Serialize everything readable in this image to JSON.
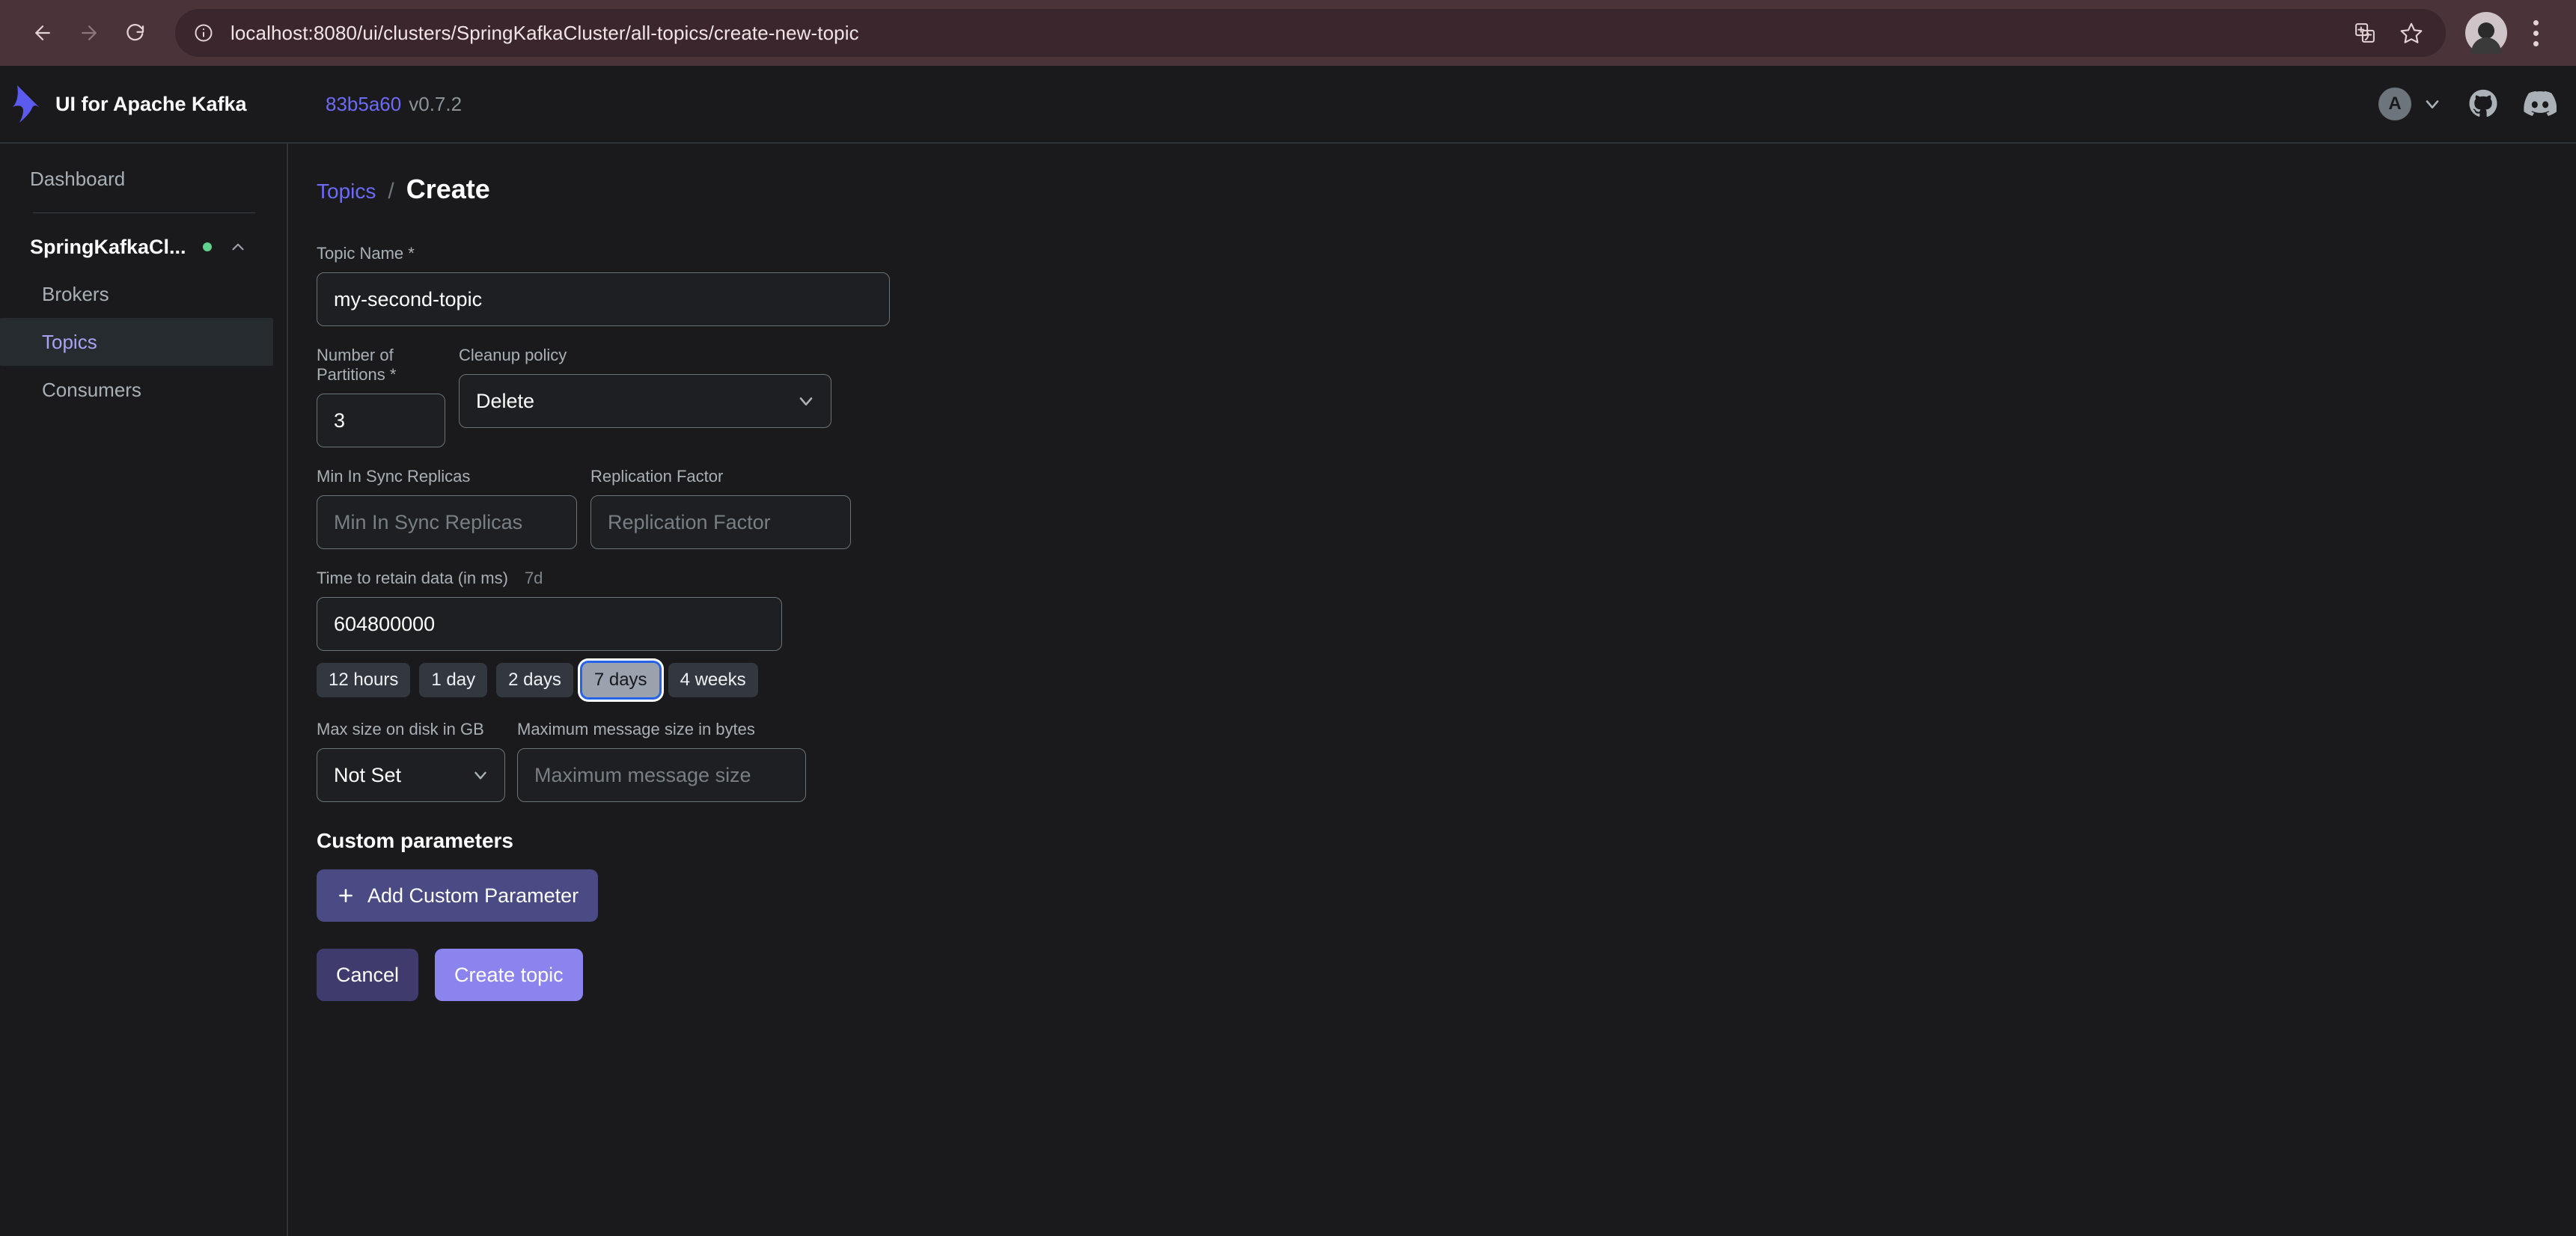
{
  "browser": {
    "back_icon": "arrow-left-icon",
    "forward_icon": "arrow-right-icon",
    "reload_icon": "reload-icon",
    "site_info_icon": "info-circle-icon",
    "url": "localhost:8080/ui/clusters/SpringKafkaCluster/all-topics/create-new-topic",
    "translate_icon": "translate-icon",
    "bookmark_icon": "star-icon",
    "profile_icon": "profile-avatar",
    "menu_icon": "kebab-menu-icon",
    "chrome_bg": "#4a3339",
    "omnibox_bg": "#3a262c"
  },
  "header": {
    "logo_icon": "kafka-ui-logo",
    "brand": "UI for Apache Kafka",
    "commit": "83b5a60",
    "version": "v0.7.2",
    "user_initial": "A",
    "user_chevron_icon": "chevron-down-icon",
    "github_icon": "github-icon",
    "discord_icon": "discord-icon",
    "accent": "#6b6bf5"
  },
  "sidebar": {
    "dashboard": "Dashboard",
    "cluster": {
      "name": "SpringKafkaCl...",
      "status_color": "#5fd38d",
      "chevron_icon": "chevron-up-icon"
    },
    "items": [
      {
        "label": "Brokers",
        "active": false
      },
      {
        "label": "Topics",
        "active": true
      },
      {
        "label": "Consumers",
        "active": false
      }
    ]
  },
  "main": {
    "breadcrumb": {
      "parent": "Topics",
      "separator": "/",
      "current": "Create"
    },
    "topic_name": {
      "label": "Topic Name *",
      "value": "my-second-topic"
    },
    "partitions": {
      "label": "Number of Partitions *",
      "value": "3"
    },
    "cleanup_policy": {
      "label": "Cleanup policy",
      "value": "Delete",
      "chevron_icon": "chevron-down-icon"
    },
    "min_in_sync_replicas": {
      "label": "Min In Sync Replicas",
      "value": "",
      "placeholder": "Min In Sync Replicas"
    },
    "replication_factor": {
      "label": "Replication Factor",
      "value": "",
      "placeholder": "Replication Factor"
    },
    "retention": {
      "label": "Time to retain data (in ms)",
      "hint": "7d",
      "value": "604800000",
      "chips": [
        {
          "label": "12 hours",
          "selected": false
        },
        {
          "label": "1 day",
          "selected": false
        },
        {
          "label": "2 days",
          "selected": false
        },
        {
          "label": "7 days",
          "selected": true
        },
        {
          "label": "4 weeks",
          "selected": false
        }
      ]
    },
    "max_size_on_disk": {
      "label": "Max size on disk in GB",
      "value": "Not Set",
      "chevron_icon": "chevron-down-icon"
    },
    "max_message_size": {
      "label": "Maximum message size in bytes",
      "value": "",
      "placeholder": "Maximum message size"
    },
    "custom_parameters": {
      "title": "Custom parameters",
      "add_button": "Add Custom Parameter",
      "add_icon": "plus-icon"
    },
    "actions": {
      "cancel": "Cancel",
      "submit": "Create topic"
    }
  }
}
